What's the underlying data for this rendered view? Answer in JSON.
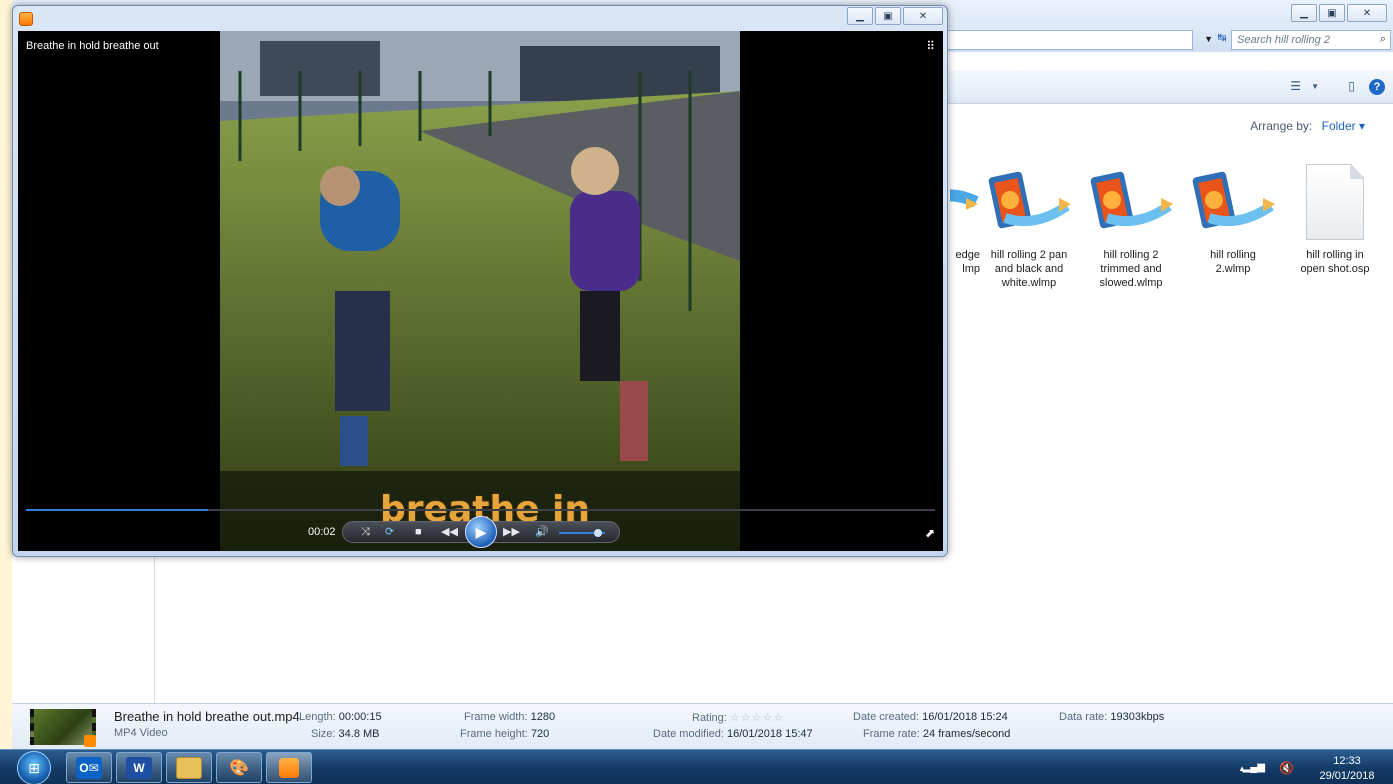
{
  "explorer": {
    "search_placeholder": "Search hill rolling 2",
    "arrange_label": "Arrange by:",
    "arrange_value": "Folder ▾",
    "files": [
      {
        "label_line1": "edge",
        "label_line2": "lmp",
        "icon": "wlmp-icon"
      },
      {
        "label_line1": "hill rolling 2 pan",
        "label_line2": "and black and",
        "label_line3": "white.wlmp",
        "icon": "wlmp-icon"
      },
      {
        "label_line1": "hill rolling 2",
        "label_line2": "trimmed and",
        "label_line3": "slowed.wlmp",
        "icon": "wlmp-icon"
      },
      {
        "label_line1": "hill rolling",
        "label_line2": "2.wlmp",
        "icon": "wlmp-icon"
      },
      {
        "label_line1": "hill rolling in",
        "label_line2": "open shot.osp",
        "icon": "document-icon"
      }
    ],
    "details": {
      "name": "Breathe in hold breathe out.mp4",
      "type": "MP4 Video",
      "length_label": "Length:",
      "length": "00:00:15",
      "size_label": "Size:",
      "size": "34.8 MB",
      "frame_width_label": "Frame width:",
      "frame_width": "1280",
      "frame_height_label": "Frame height:",
      "frame_height": "720",
      "rating_label": "Rating:",
      "rating_stars": 0,
      "date_modified_label": "Date modified:",
      "date_modified": "16/01/2018 15:47",
      "date_created_label": "Date created:",
      "date_created": "16/01/2018 15:24",
      "frame_rate_label": "Frame rate:",
      "frame_rate": "24 frames/second",
      "data_rate_label": "Data rate:",
      "data_rate": "19303kbps"
    }
  },
  "player": {
    "title": "Breathe in hold breathe out",
    "caption_text": "breathe in",
    "time": "00:02",
    "progress_fraction": 0.2,
    "volume_fraction": 0.85
  },
  "taskbar": {
    "apps": [
      {
        "name": "outlook",
        "glyph": "O✉",
        "color": "#0b63c5"
      },
      {
        "name": "word",
        "glyph": "W",
        "color": "#1f4ea5"
      },
      {
        "name": "explorer",
        "glyph": "",
        "color": "#e8c15a"
      },
      {
        "name": "paint",
        "glyph": "",
        "color": "#6a9fd6"
      },
      {
        "name": "media-player",
        "glyph": "",
        "color": "#ff8a00"
      }
    ],
    "clock_time": "12:33",
    "clock_date": "29/01/2018"
  },
  "colors": {
    "accent": "#2f7fd6",
    "caption_text": "#e7a43a",
    "link": "#1d5fb8"
  }
}
